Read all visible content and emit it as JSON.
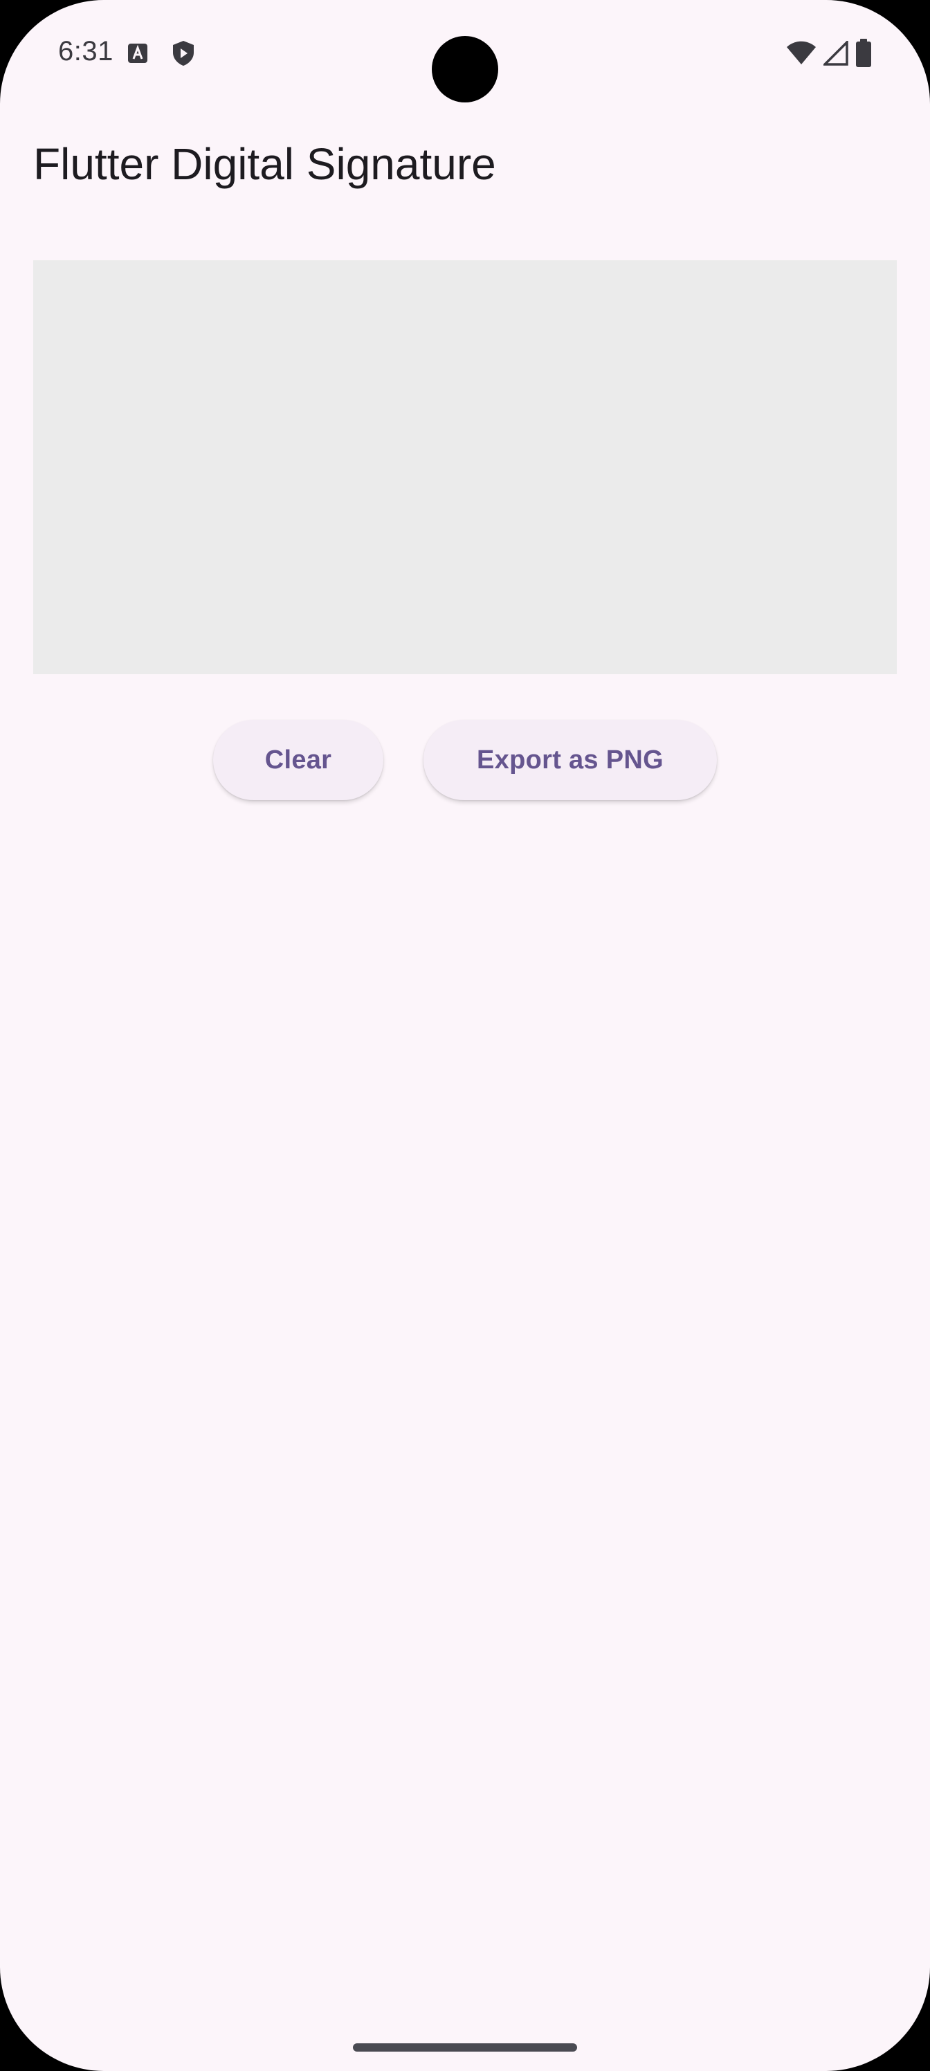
{
  "status_bar": {
    "time": "6:31",
    "icons": [
      "keyboard-a-icon",
      "shield-icon",
      "wifi-icon",
      "signal-icon",
      "battery-icon"
    ]
  },
  "app_bar": {
    "title": "Flutter Digital Signature"
  },
  "signature_pad": {
    "background_color": "#ebebeb"
  },
  "buttons": {
    "clear_label": "Clear",
    "export_label": "Export as PNG"
  },
  "colors": {
    "background": "#fcf5fa",
    "button_background": "#f5edf6",
    "button_text": "#65558f",
    "title_text": "#1d1b20"
  }
}
